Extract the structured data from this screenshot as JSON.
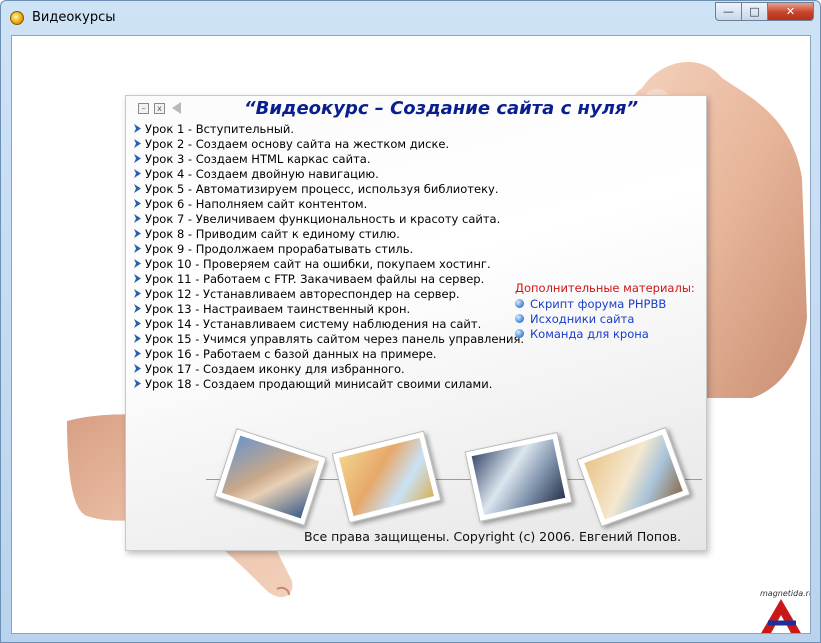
{
  "window": {
    "title": "Видеокурсы",
    "minimize_glyph": "—",
    "maximize_glyph": "□",
    "close_glyph": "✕"
  },
  "card": {
    "title": "“Видеокурс – Создание сайта с нуля”",
    "controls": {
      "minimize_glyph": "–",
      "close_glyph": "x",
      "sound_icon": "speaker-icon"
    },
    "lessons": [
      "Урок 1 - Вступительный.",
      "Урок 2 - Создаем основу сайта на жестком диске.",
      "Урок 3 - Создаем HTML каркас сайта.",
      "Урок 4 - Создаем двойную навигацию.",
      "Урок 5 - Автоматизируем процесс, используя библиотеку.",
      "Урок 6 - Наполняем сайт контентом.",
      "Урок 7 - Увеличиваем функциональность и красоту сайта.",
      "Урок 8 - Приводим сайт к единому стилю.",
      "Урок 9 - Продолжаем прорабатывать стиль.",
      "Урок 10 - Проверяем сайт на ошибки, покупаем хостинг.",
      "Урок 11 - Работаем с FTP. Закачиваем файлы на сервер.",
      "Урок 12 - Устанавливаем автореспондер на сервер.",
      "Урок 13 - Настраиваем таинственный крон.",
      "Урок 14 - Устанавливаем систему наблюдения на сайт.",
      "Урок 15 - Учимся управлять сайтом через панель управления.",
      "Урок 16 - Работаем с базой данных на примере.",
      "Урок 17 - Создаем иконку для избранного.",
      "Урок 18 - Создаем продающий минисайт своими силами."
    ],
    "extras": {
      "title": "Дополнительные материалы:",
      "links": [
        "Скрипт форума PHPBB",
        "Исходники сайта",
        "Команда для крона"
      ]
    },
    "copyright": "Все права защищены. Copyright (c) 2006. Евгений Попов."
  },
  "watermark": {
    "text": "magnetida.ru"
  },
  "colors": {
    "title_blue": "#0a1f8f",
    "extras_red": "#d01515",
    "link_blue": "#1a3ec8",
    "arrow_blue": "#2a5fb0"
  }
}
